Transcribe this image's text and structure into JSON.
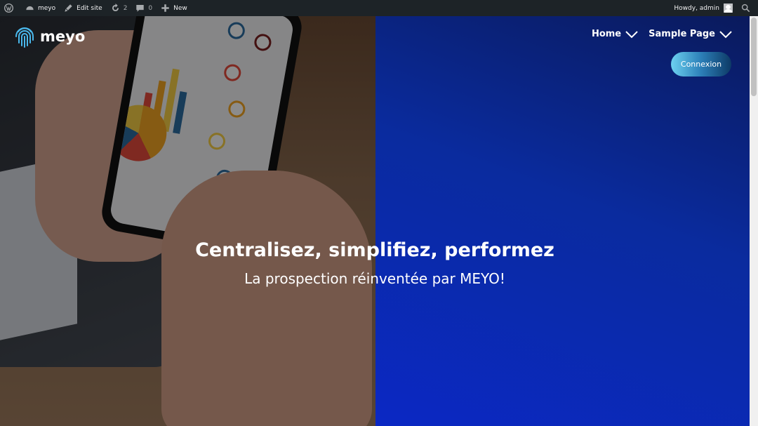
{
  "admin_bar": {
    "site_name": "meyo",
    "edit_site": "Edit site",
    "updates_count": "2",
    "comments_count": "0",
    "new_label": "New",
    "howdy": "Howdy, admin"
  },
  "header": {
    "logo_text": "meyo",
    "nav": [
      {
        "label": "Home"
      },
      {
        "label": "Sample Page"
      }
    ],
    "cta_label": "Connexion"
  },
  "hero": {
    "headline": "Centralisez, simplifiez, performez",
    "subheadline": "La prospection réinventée par MEYO!"
  },
  "colors": {
    "admin_bar_bg": "#1d2327",
    "hero_gradient_start": "#0a1a5c",
    "hero_gradient_end": "#0b28c4",
    "cta_gradient": [
      "#6dd1f0",
      "#0d3a66"
    ]
  }
}
